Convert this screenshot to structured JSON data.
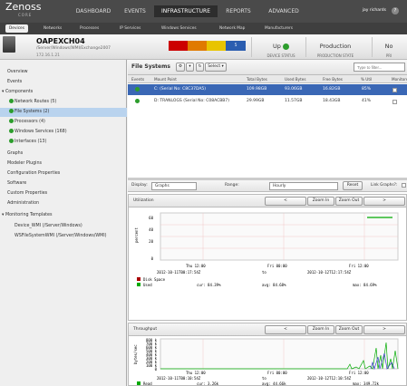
{
  "app": {
    "logo": "Zenoss",
    "logo_sub": "CORE",
    "user": "jay richards",
    "help": "?"
  },
  "nav": [
    {
      "label": "DASHBOARD"
    },
    {
      "label": "EVENTS"
    },
    {
      "label": "INFRASTRUCTURE"
    },
    {
      "label": "REPORTS"
    },
    {
      "label": "ADVANCED"
    }
  ],
  "subnav": [
    {
      "label": "Devices"
    },
    {
      "label": "Networks"
    },
    {
      "label": "Processes"
    },
    {
      "label": "IP Services"
    },
    {
      "label": "Windows Services"
    },
    {
      "label": "Network Map"
    },
    {
      "label": "Manufacturers"
    }
  ],
  "device": {
    "title": "OAPEXCH04",
    "path": "/Server/Windows/WMI/Exchange2007",
    "ip": "172.16.1.21",
    "events_count": "5",
    "status_value": "Up",
    "status_label": "DEVICE STATUS",
    "state_value": "Production",
    "state_label": "PRODUCTION STATE",
    "priority_value": "No",
    "priority_label": "PRI"
  },
  "sidebar": {
    "items": [
      {
        "label": "Overview"
      },
      {
        "label": "Events"
      },
      {
        "label": "Components"
      },
      {
        "label": "Network Routes (5)"
      },
      {
        "label": "File Systems (2)"
      },
      {
        "label": "Processors (4)"
      },
      {
        "label": "Windows Services (168)"
      },
      {
        "label": "Interfaces (13)"
      },
      {
        "label": "Graphs"
      },
      {
        "label": "Modeler Plugins"
      },
      {
        "label": "Configuration Properties"
      },
      {
        "label": "Software"
      },
      {
        "label": "Custom Properties"
      },
      {
        "label": "Administration"
      },
      {
        "label": "Monitoring Templates"
      },
      {
        "label": "Device_WMI (/Server/Windows)"
      },
      {
        "label": "WSFileSystemWMI (/Server/Windows/WMI)"
      }
    ]
  },
  "filesystems": {
    "title": "File Systems",
    "select_label": "Select",
    "filter_placeholder": "Type to filter...",
    "columns": [
      "Events",
      "Mount Point",
      "Total Bytes",
      "Used Bytes",
      "Free Bytes",
      "% Util",
      "Monitored"
    ],
    "rows": [
      {
        "mount": "C: (Serial No: C8C37DA5)",
        "total": "109.98GB",
        "used": "93.06GB",
        "free": "16.82GB",
        "util": "85%"
      },
      {
        "mount": "D: TRANLOGS (Serial No: C08ACBB7)",
        "total": "29.99GB",
        "used": "11.57GB",
        "free": "18.43GB",
        "util": "41%"
      }
    ]
  },
  "graph_controls": {
    "display_label": "Display:",
    "display_value": "Graphs",
    "range_label": "Range:",
    "range_value": "Hourly",
    "reset_label": "Reset",
    "link_label": "Link Graphs?:"
  },
  "graphs": [
    {
      "title": "Utilization",
      "prev": "<",
      "zoom_in": "Zoom In",
      "zoom_out": "Zoom Out",
      "next": ">",
      "ylabel": "percent",
      "ticks": [
        "60",
        "40",
        "20",
        "0"
      ],
      "xticks": [
        "Thu 12:00",
        "Fri 00:00",
        "Fri 12:00"
      ],
      "from": "2012-10-11T00:17:54Z",
      "to_label": "to",
      "to": "2012-10-12T12:17:54Z",
      "legend": [
        {
          "name": "Disk Space",
          "color": "#aa0000"
        },
        {
          "name": "Used",
          "color": "#00aa00",
          "cur": "cur: 84.39%",
          "avg": "avg: 84.68%",
          "max": "max: 84.69%"
        }
      ]
    },
    {
      "title": "Throughput",
      "prev": "<",
      "zoom_in": "Zoom In",
      "zoom_out": "Zoom Out",
      "next": ">",
      "ylabel": "bytes/sec",
      "ticks": [
        "800 k",
        "700 k",
        "600 k",
        "500 k",
        "400 k",
        "300 k",
        "200 k",
        "100 k",
        "0"
      ],
      "xticks": [
        "Thu 12:00",
        "Fri 00:00",
        "Fri 12:00"
      ],
      "from": "2012-10-11T00:10:54Z",
      "to_label": "to",
      "to": "2012-10-12T12:10:54Z",
      "legend": [
        {
          "name": "Read",
          "color": "#00aa00",
          "cur": "cur: 3.26k",
          "avg": "avg: 44.66k",
          "max": "max: 349.72k"
        }
      ]
    }
  ],
  "colors": {
    "topbar": "#4a4a4a",
    "selected_row": "#3a67b5",
    "sidebar_selected": "#b9d3ee",
    "status_green": "#2c9d2c"
  }
}
